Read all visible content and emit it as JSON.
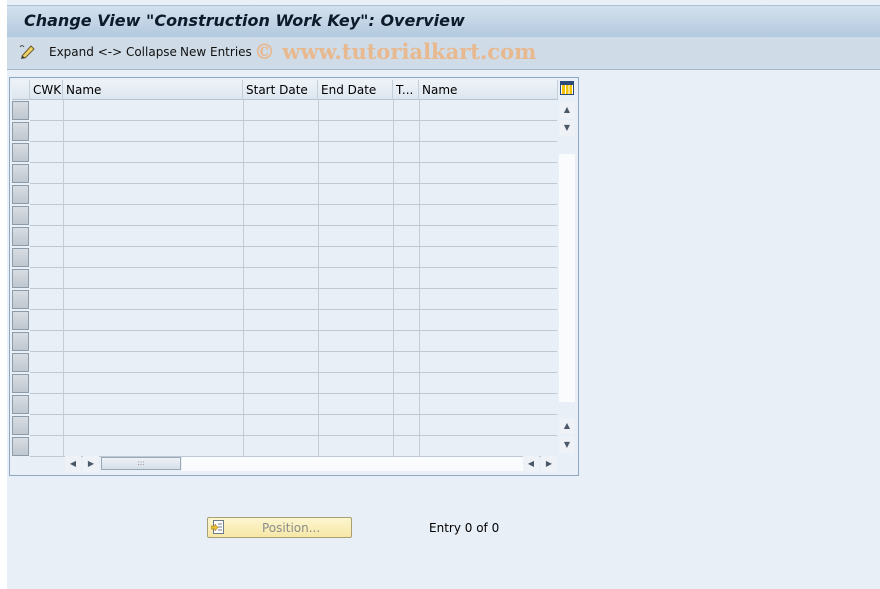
{
  "window": {
    "title": "Change View \"Construction Work Key\": Overview"
  },
  "toolbar": {
    "items": [
      {
        "icon": "edit-pencil-icon",
        "label": ""
      },
      {
        "label": "Expand <-> Collapse"
      },
      {
        "label": "New Entries"
      }
    ],
    "watermark": "© www.tutorialkart.com"
  },
  "table": {
    "columns": [
      "CWK",
      "Name",
      "Start Date",
      "End Date",
      "T...",
      "Name"
    ],
    "row_count": 17,
    "rows": []
  },
  "footer": {
    "position_button": "Position...",
    "entry_text": "Entry 0 of 0"
  }
}
